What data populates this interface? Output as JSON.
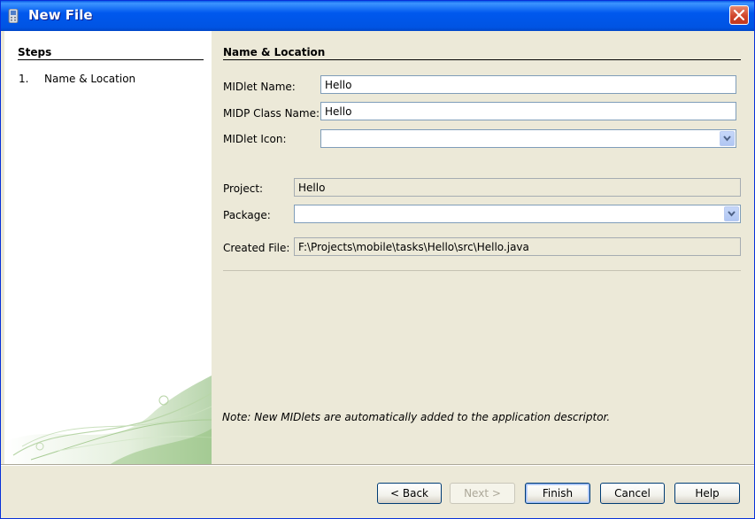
{
  "window": {
    "title": "New File"
  },
  "steps": {
    "heading": "Steps",
    "items": [
      {
        "number": "1.",
        "label": "Name & Location"
      }
    ]
  },
  "form": {
    "section_title": "Name & Location",
    "midlet_name": {
      "label": "MIDlet Name:",
      "value": "Hello"
    },
    "midp_class_name": {
      "label": "MIDP Class Name:",
      "value": "Hello"
    },
    "midlet_icon": {
      "label": "MIDlet Icon:",
      "value": ""
    },
    "project": {
      "label": "Project:",
      "value": "Hello"
    },
    "package": {
      "label": "Package:",
      "value": ""
    },
    "created_file": {
      "label": "Created File:",
      "value": "F:\\Projects\\mobile\\tasks\\Hello\\src\\Hello.java"
    },
    "note": "Note: New MIDlets are automatically added to the application descriptor."
  },
  "buttons": {
    "back": "< Back",
    "next": "Next >",
    "finish": "Finish",
    "cancel": "Cancel",
    "help": "Help"
  },
  "icons": {
    "title_icon": "phone-icon",
    "close_icon": "close-icon",
    "combo_icon": "chevron-down-icon"
  },
  "colors": {
    "titlebar": "#0054e3",
    "close_button": "#d0462c",
    "panel_background": "#ece9d8",
    "steps_background": "#ffffff"
  }
}
